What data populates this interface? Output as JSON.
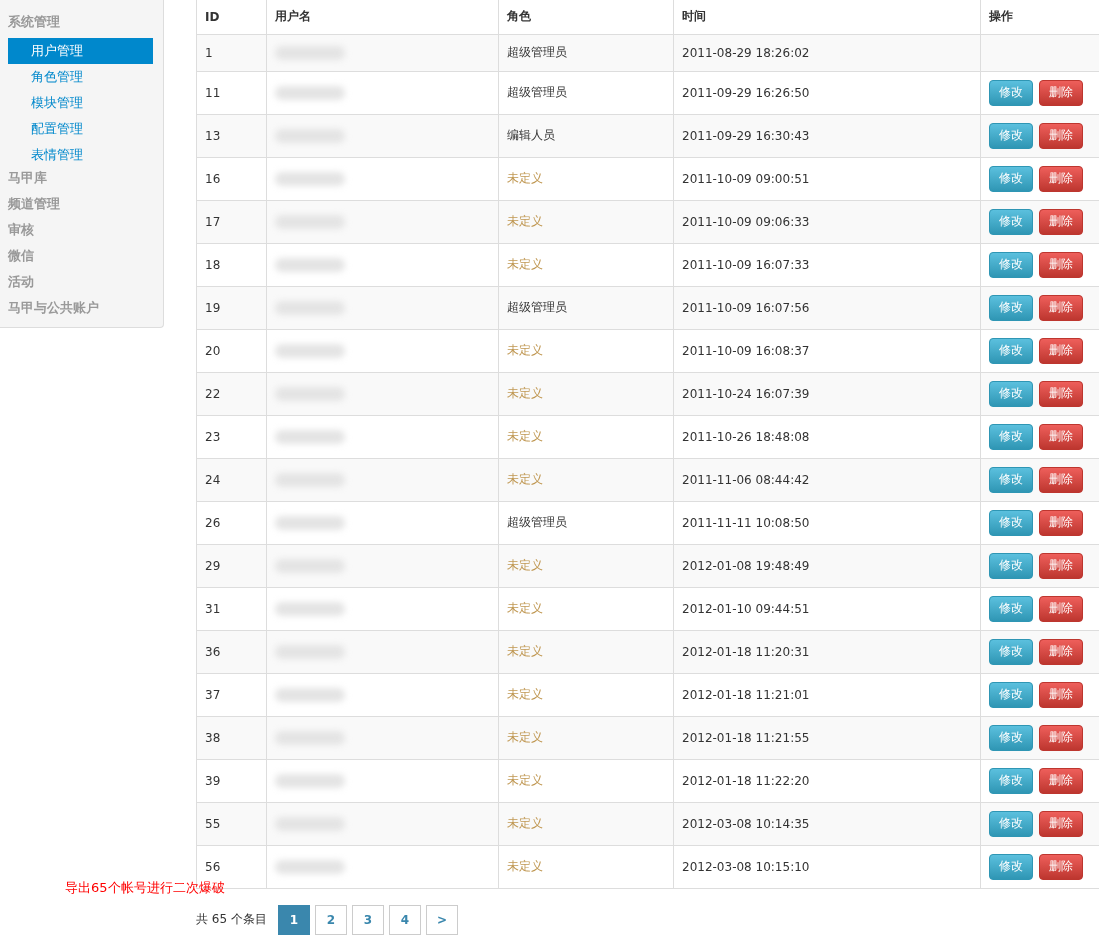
{
  "sidebar": {
    "items": [
      {
        "label": "系统管理",
        "children": [
          {
            "label": "用户管理",
            "selected": true
          },
          {
            "label": "角色管理",
            "selected": false
          },
          {
            "label": "模块管理",
            "selected": false
          },
          {
            "label": "配置管理",
            "selected": false
          },
          {
            "label": "表情管理",
            "selected": false
          }
        ]
      },
      {
        "label": "马甲库"
      },
      {
        "label": "频道管理"
      },
      {
        "label": "审核"
      },
      {
        "label": "微信"
      },
      {
        "label": "活动"
      },
      {
        "label": "马甲与公共账户"
      }
    ]
  },
  "table": {
    "columns": [
      "ID",
      "用户名",
      "角色",
      "时间",
      "操作"
    ],
    "rows": [
      {
        "id": "1",
        "role": "超级管理员",
        "kind": "assigned",
        "time": "2011-08-29 18:26:02"
      },
      {
        "id": "11",
        "role": "超级管理员",
        "kind": "assigned",
        "time": "2011-09-29 16:26:50",
        "actions": [
          {
            "label": "修改",
            "kind": "edit"
          },
          {
            "label": "删除",
            "kind": "delete"
          }
        ]
      },
      {
        "id": "13",
        "role": "编辑人员",
        "kind": "assigned",
        "time": "2011-09-29 16:30:43",
        "actions": [
          {
            "label": "修改",
            "kind": "edit"
          },
          {
            "label": "删除",
            "kind": "delete"
          }
        ]
      },
      {
        "id": "16",
        "role": "未定义",
        "kind": "undefined",
        "time": "2011-10-09 09:00:51",
        "actions": [
          {
            "label": "修改",
            "kind": "edit"
          },
          {
            "label": "删除",
            "kind": "delete"
          }
        ]
      },
      {
        "id": "17",
        "role": "未定义",
        "kind": "undefined",
        "time": "2011-10-09 09:06:33",
        "actions": [
          {
            "label": "修改",
            "kind": "edit"
          },
          {
            "label": "删除",
            "kind": "delete"
          }
        ]
      },
      {
        "id": "18",
        "role": "未定义",
        "kind": "undefined",
        "time": "2011-10-09 16:07:33",
        "actions": [
          {
            "label": "修改",
            "kind": "edit"
          },
          {
            "label": "删除",
            "kind": "delete"
          }
        ]
      },
      {
        "id": "19",
        "role": "超级管理员",
        "kind": "assigned",
        "time": "2011-10-09 16:07:56",
        "actions": [
          {
            "label": "修改",
            "kind": "edit"
          },
          {
            "label": "删除",
            "kind": "delete"
          }
        ]
      },
      {
        "id": "20",
        "role": "未定义",
        "kind": "undefined",
        "time": "2011-10-09 16:08:37",
        "actions": [
          {
            "label": "修改",
            "kind": "edit"
          },
          {
            "label": "删除",
            "kind": "delete"
          }
        ]
      },
      {
        "id": "22",
        "role": "未定义",
        "kind": "undefined",
        "time": "2011-10-24 16:07:39",
        "actions": [
          {
            "label": "修改",
            "kind": "edit"
          },
          {
            "label": "删除",
            "kind": "delete"
          }
        ]
      },
      {
        "id": "23",
        "role": "未定义",
        "kind": "undefined",
        "time": "2011-10-26 18:48:08",
        "actions": [
          {
            "label": "修改",
            "kind": "edit"
          },
          {
            "label": "删除",
            "kind": "delete"
          }
        ]
      },
      {
        "id": "24",
        "role": "未定义",
        "kind": "undefined",
        "time": "2011-11-06 08:44:42",
        "actions": [
          {
            "label": "修改",
            "kind": "edit"
          },
          {
            "label": "删除",
            "kind": "delete"
          }
        ]
      },
      {
        "id": "26",
        "role": "超级管理员",
        "kind": "assigned",
        "time": "2011-11-11 10:08:50",
        "actions": [
          {
            "label": "修改",
            "kind": "edit"
          },
          {
            "label": "删除",
            "kind": "delete"
          }
        ]
      },
      {
        "id": "29",
        "role": "未定义",
        "kind": "undefined",
        "time": "2012-01-08 19:48:49",
        "actions": [
          {
            "label": "修改",
            "kind": "edit"
          },
          {
            "label": "删除",
            "kind": "delete"
          }
        ]
      },
      {
        "id": "31",
        "role": "未定义",
        "kind": "undefined",
        "time": "2012-01-10 09:44:51",
        "actions": [
          {
            "label": "修改",
            "kind": "edit"
          },
          {
            "label": "删除",
            "kind": "delete"
          }
        ]
      },
      {
        "id": "36",
        "role": "未定义",
        "kind": "undefined",
        "time": "2012-01-18 11:20:31",
        "actions": [
          {
            "label": "修改",
            "kind": "edit"
          },
          {
            "label": "删除",
            "kind": "delete"
          }
        ]
      },
      {
        "id": "37",
        "role": "未定义",
        "kind": "undefined",
        "time": "2012-01-18 11:21:01",
        "actions": [
          {
            "label": "修改",
            "kind": "edit"
          },
          {
            "label": "删除",
            "kind": "delete"
          }
        ]
      },
      {
        "id": "38",
        "role": "未定义",
        "kind": "undefined",
        "time": "2012-01-18 11:21:55",
        "actions": [
          {
            "label": "修改",
            "kind": "edit"
          },
          {
            "label": "删除",
            "kind": "delete"
          }
        ]
      },
      {
        "id": "39",
        "role": "未定义",
        "kind": "undefined",
        "time": "2012-01-18 11:22:20",
        "actions": [
          {
            "label": "修改",
            "kind": "edit"
          },
          {
            "label": "删除",
            "kind": "delete"
          }
        ]
      },
      {
        "id": "55",
        "role": "未定义",
        "kind": "undefined",
        "time": "2012-03-08 10:14:35",
        "actions": [
          {
            "label": "修改",
            "kind": "edit"
          },
          {
            "label": "删除",
            "kind": "delete"
          }
        ]
      },
      {
        "id": "56",
        "role": "未定义",
        "kind": "undefined",
        "time": "2012-03-08 10:15:10",
        "actions": [
          {
            "label": "修改",
            "kind": "edit"
          },
          {
            "label": "删除",
            "kind": "delete"
          }
        ]
      }
    ]
  },
  "pagination": {
    "summary": "共 65 个条目",
    "pages": [
      {
        "label": "1",
        "selected": true
      },
      {
        "label": "2",
        "selected": false
      },
      {
        "label": "3",
        "selected": false
      },
      {
        "label": "4",
        "selected": false
      },
      {
        "label": ">",
        "selected": false
      }
    ]
  },
  "annotation": "导出65个帐号进行二次爆破"
}
